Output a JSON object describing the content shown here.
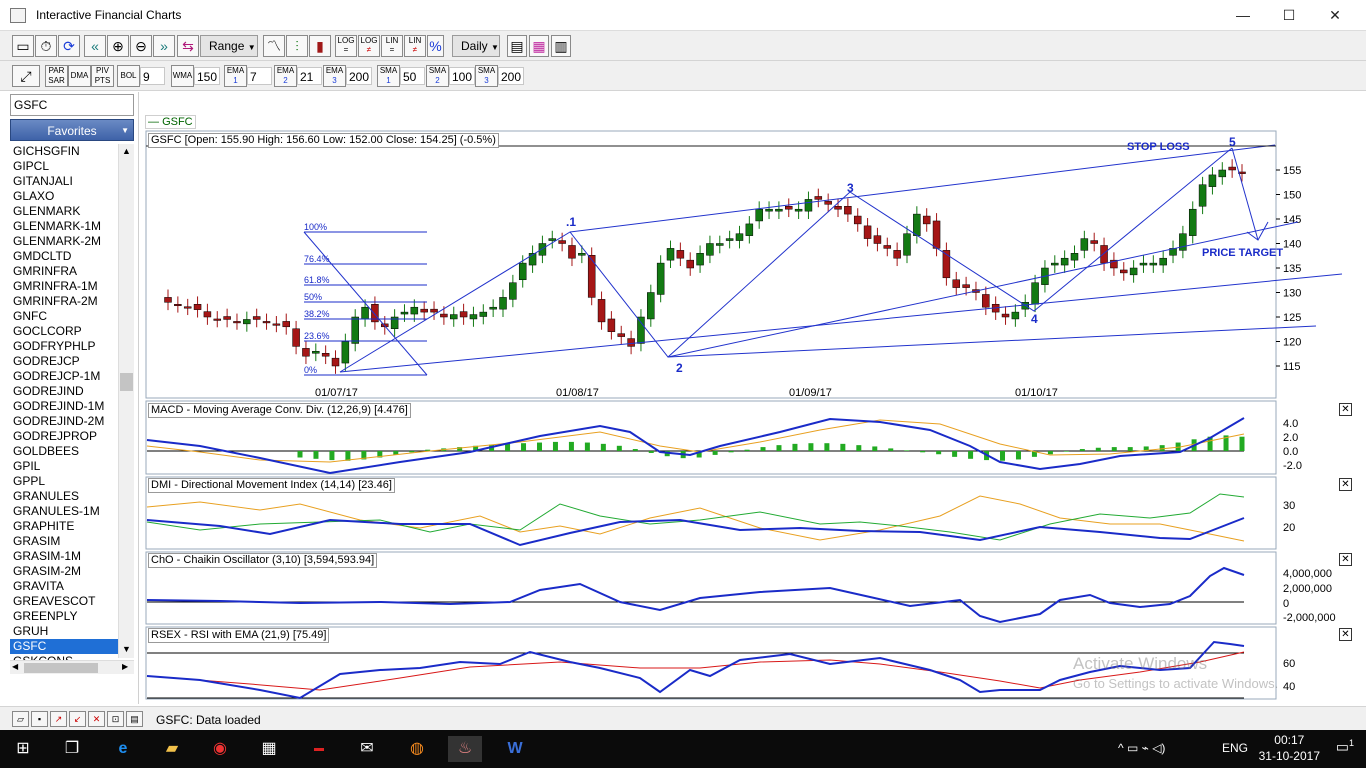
{
  "window": {
    "title": "Interactive Financial Charts",
    "minimize": "—",
    "maximize": "☐",
    "close": "✕"
  },
  "toolbar1": {
    "range_label": "Range",
    "period_label": "Daily",
    "log1": [
      "LOG",
      "="
    ],
    "log2": [
      "LOG",
      "≠"
    ],
    "lin1": [
      "LIN",
      "="
    ],
    "lin2": [
      "LIN",
      "≠"
    ],
    "pct": "%"
  },
  "toolbar2": {
    "par_sar": [
      "PAR",
      "SAR"
    ],
    "dma": "DMA",
    "piv_pts": [
      "PIV",
      "PTS"
    ],
    "bol_label": "BOL",
    "bol_value": "9",
    "wma_label": "WMA",
    "wma_value": "150",
    "ema1_label": "EMA",
    "ema1_num": "1",
    "ema1_value": "7",
    "ema2_label": "EMA",
    "ema2_num": "2",
    "ema2_value": "21",
    "ema3_label": "EMA",
    "ema3_num": "3",
    "ema3_value": "200",
    "sma1_label": "SMA",
    "sma1_num": "1",
    "sma1_value": "50",
    "sma2_label": "SMA",
    "sma2_num": "2",
    "sma2_value": "100",
    "sma3_label": "SMA",
    "sma3_num": "3",
    "sma3_value": "200"
  },
  "sidebar": {
    "symbol": "GSFC",
    "favorites_label": "Favorites",
    "items": [
      "GICHSGFIN",
      "GIPCL",
      "GITANJALI",
      "GLAXO",
      "GLENMARK",
      "GLENMARK-1M",
      "GLENMARK-2M",
      "GMDCLTD",
      "GMRINFRA",
      "GMRINFRA-1M",
      "GMRINFRA-2M",
      "GNFC",
      "GOCLCORP",
      "GODFRYPHLP",
      "GODREJCP",
      "GODREJCP-1M",
      "GODREJIND",
      "GODREJIND-1M",
      "GODREJIND-2M",
      "GODREJPROP",
      "GOLDBEES",
      "GPIL",
      "GPPL",
      "GRANULES",
      "GRANULES-1M",
      "GRAPHITE",
      "GRASIM",
      "GRASIM-1M",
      "GRASIM-2M",
      "GRAVITA",
      "GREAVESCOT",
      "GREENPLY",
      "GRUH",
      "GSFC",
      "GSKCONS"
    ],
    "selected": "GSFC"
  },
  "chart": {
    "legend": "GSFC",
    "price_title": "GSFC [Open: 155.90  High: 156.60  Low: 152.00  Close: 154.25] (-0.5%)",
    "peak_label": "156.60",
    "macd_title": "MACD - Moving Average Conv. Div. (12,26,9) [4.476]",
    "dmi_title": "DMI - Directional Movement Index (14,14) [23.46]",
    "cho_title": "ChO - Chaikin Oscillator (3,10) [3,594,593.94]",
    "rsi_title": "RSEX - RSI with EMA (21,9) [75.49]",
    "close_glyph": "✕",
    "dates": [
      "01/07/17",
      "01/08/17",
      "01/09/17",
      "01/10/17"
    ],
    "price_ticks": [
      "155",
      "150",
      "145",
      "140",
      "135",
      "130",
      "125",
      "120",
      "115"
    ],
    "macd_ticks": [
      "4.0",
      "2.0",
      "0.0",
      "-2.0"
    ],
    "dmi_ticks": [
      "30",
      "20"
    ],
    "cho_ticks": [
      "4,000,000",
      "2,000,000",
      "0",
      "-2,000,000"
    ],
    "rsi_ticks": [
      "60",
      "40"
    ],
    "fib_levels": [
      "100%",
      "76.4%",
      "61.8%",
      "50%",
      "38.2%",
      "23.6%",
      "0%"
    ],
    "wave_labels": [
      ".1",
      "2",
      "3",
      "4",
      "5"
    ],
    "annotations": {
      "stop_loss": "STOP LOSS",
      "price_target": "PRICE TARGET"
    }
  },
  "chart_data": {
    "type": "candlestick",
    "title": "GSFC [Open: 155.90  High: 156.60  Low: 152.00  Close: 154.25] (-0.5%)",
    "x_ticks": [
      "01/07/17",
      "01/08/17",
      "01/09/17",
      "01/10/17"
    ],
    "ylim": [
      112,
      158
    ],
    "y_ticks": [
      115,
      120,
      125,
      130,
      135,
      140,
      145,
      150,
      155
    ],
    "close_series": [
      128,
      127.5,
      127,
      126.5,
      125,
      124.5,
      124.5,
      124,
      124.5,
      124.5,
      124,
      123.5,
      123,
      119,
      117,
      118,
      117,
      115,
      120,
      125,
      127,
      124,
      123,
      125,
      126,
      127,
      126,
      126,
      125,
      125.5,
      125,
      125.5,
      126,
      127,
      129,
      132,
      136,
      138,
      140,
      141,
      140,
      137,
      138,
      129,
      124,
      122,
      121,
      119,
      125,
      130,
      136,
      139,
      137,
      135,
      138,
      140,
      140,
      141,
      142,
      144,
      147,
      147,
      147,
      147,
      147,
      149,
      149,
      148,
      147,
      146,
      144,
      141,
      140,
      139,
      137,
      142,
      146,
      144,
      139,
      133,
      131,
      131,
      130,
      127,
      126,
      125,
      126,
      128,
      132,
      135,
      136,
      137,
      138,
      141,
      140,
      136,
      135,
      134,
      135,
      136,
      136,
      137,
      139,
      142,
      147,
      152,
      154,
      155,
      155,
      154.25
    ],
    "wave_points": [
      {
        "label": ".1",
        "value": 142
      },
      {
        "label": "2",
        "value": 116
      },
      {
        "label": "3",
        "value": 149
      },
      {
        "label": "4",
        "value": 126
      },
      {
        "label": "5",
        "value": 156.6
      }
    ],
    "fibonacci_levels": [
      "100%",
      "76.4%",
      "61.8%",
      "50%",
      "38.2%",
      "23.6%",
      "0%"
    ],
    "annotations": [
      "STOP LOSS",
      "PRICE TARGET"
    ],
    "indicators": [
      {
        "name": "MACD - Moving Average Conv. Div. (12,26,9)",
        "last": 4.476,
        "ylim": [
          -3,
          5
        ]
      },
      {
        "name": "DMI - Directional Movement Index (14,14)",
        "last": 23.46
      },
      {
        "name": "ChO - Chaikin Oscillator (3,10)",
        "last": 3594593.94
      },
      {
        "name": "RSEX - RSI with EMA (21,9)",
        "last": 75.49
      }
    ]
  },
  "status": {
    "text": "GSFC: Data loaded"
  },
  "watermark": {
    "line1": "Activate Windows",
    "line2": "Go to Settings to activate Windows."
  },
  "taskbar": {
    "lang": "ENG",
    "time": "00:17",
    "date": "31-10-2017",
    "notif_count": "1"
  }
}
